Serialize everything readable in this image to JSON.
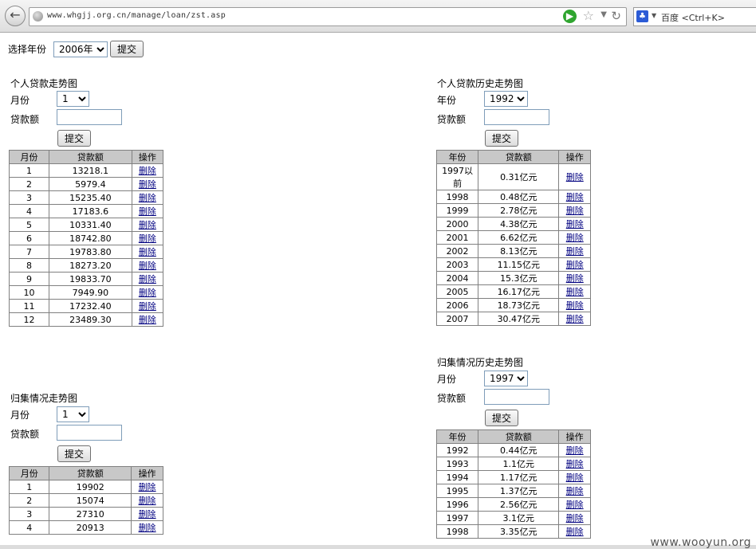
{
  "browser": {
    "url": "www.whgjj.org.cn/manage/loan/zst.asp",
    "search_placeholder": "百度 <Ctrl+K>"
  },
  "top": {
    "year_label": "选择年份",
    "year_value": "2006年",
    "submit": "提交"
  },
  "sections": {
    "personal_trend": {
      "title": "个人贷款走势图",
      "field1_label": "月份",
      "field1_value": "1",
      "field2_label": "贷款额",
      "submit": "提交",
      "headers": [
        "月份",
        "贷款额",
        "操作"
      ],
      "rows": [
        [
          "1",
          "13218.1",
          "删除"
        ],
        [
          "2",
          "5979.4",
          "删除"
        ],
        [
          "3",
          "15235.40",
          "删除"
        ],
        [
          "4",
          "17183.6",
          "删除"
        ],
        [
          "5",
          "10331.40",
          "删除"
        ],
        [
          "6",
          "18742.80",
          "删除"
        ],
        [
          "7",
          "19783.80",
          "删除"
        ],
        [
          "8",
          "18273.20",
          "删除"
        ],
        [
          "9",
          "19833.70",
          "删除"
        ],
        [
          "10",
          "7949.90",
          "删除"
        ],
        [
          "11",
          "17232.40",
          "删除"
        ],
        [
          "12",
          "23489.30",
          "删除"
        ]
      ]
    },
    "personal_history": {
      "title": "个人贷款历史走势图",
      "field1_label": "年份",
      "field1_value": "1992",
      "field2_label": "贷款额",
      "submit": "提交",
      "headers": [
        "年份",
        "贷款额",
        "操作"
      ],
      "rows": [
        [
          "1997以前",
          "0.31亿元",
          "删除"
        ],
        [
          "1998",
          "0.48亿元",
          "删除"
        ],
        [
          "1999",
          "2.78亿元",
          "删除"
        ],
        [
          "2000",
          "4.38亿元",
          "删除"
        ],
        [
          "2001",
          "6.62亿元",
          "删除"
        ],
        [
          "2002",
          "8.13亿元",
          "删除"
        ],
        [
          "2003",
          "11.15亿元",
          "删除"
        ],
        [
          "2004",
          "15.3亿元",
          "删除"
        ],
        [
          "2005",
          "16.17亿元",
          "删除"
        ],
        [
          "2006",
          "18.73亿元",
          "删除"
        ],
        [
          "2007",
          "30.47亿元",
          "删除"
        ]
      ]
    },
    "collection_trend": {
      "title": "归集情况走势图",
      "field1_label": "月份",
      "field1_value": "1",
      "field2_label": "贷款额",
      "submit": "提交",
      "headers": [
        "月份",
        "贷款额",
        "操作"
      ],
      "rows": [
        [
          "1",
          "19902",
          "删除"
        ],
        [
          "2",
          "15074",
          "删除"
        ],
        [
          "3",
          "27310",
          "删除"
        ],
        [
          "4",
          "20913",
          "删除"
        ]
      ]
    },
    "collection_history": {
      "title": "归集情况历史走势图",
      "field1_label": "月份",
      "field1_value": "1997",
      "field2_label": "贷款额",
      "submit": "提交",
      "headers": [
        "年份",
        "贷款额",
        "操作"
      ],
      "rows": [
        [
          "1992",
          "0.44亿元",
          "删除"
        ],
        [
          "1993",
          "1.1亿元",
          "删除"
        ],
        [
          "1994",
          "1.17亿元",
          "删除"
        ],
        [
          "1995",
          "1.37亿元",
          "删除"
        ],
        [
          "1996",
          "2.56亿元",
          "删除"
        ],
        [
          "1997",
          "3.1亿元",
          "删除"
        ],
        [
          "1998",
          "3.35亿元",
          "删除"
        ]
      ]
    }
  },
  "watermark": "www.wooyun.org"
}
